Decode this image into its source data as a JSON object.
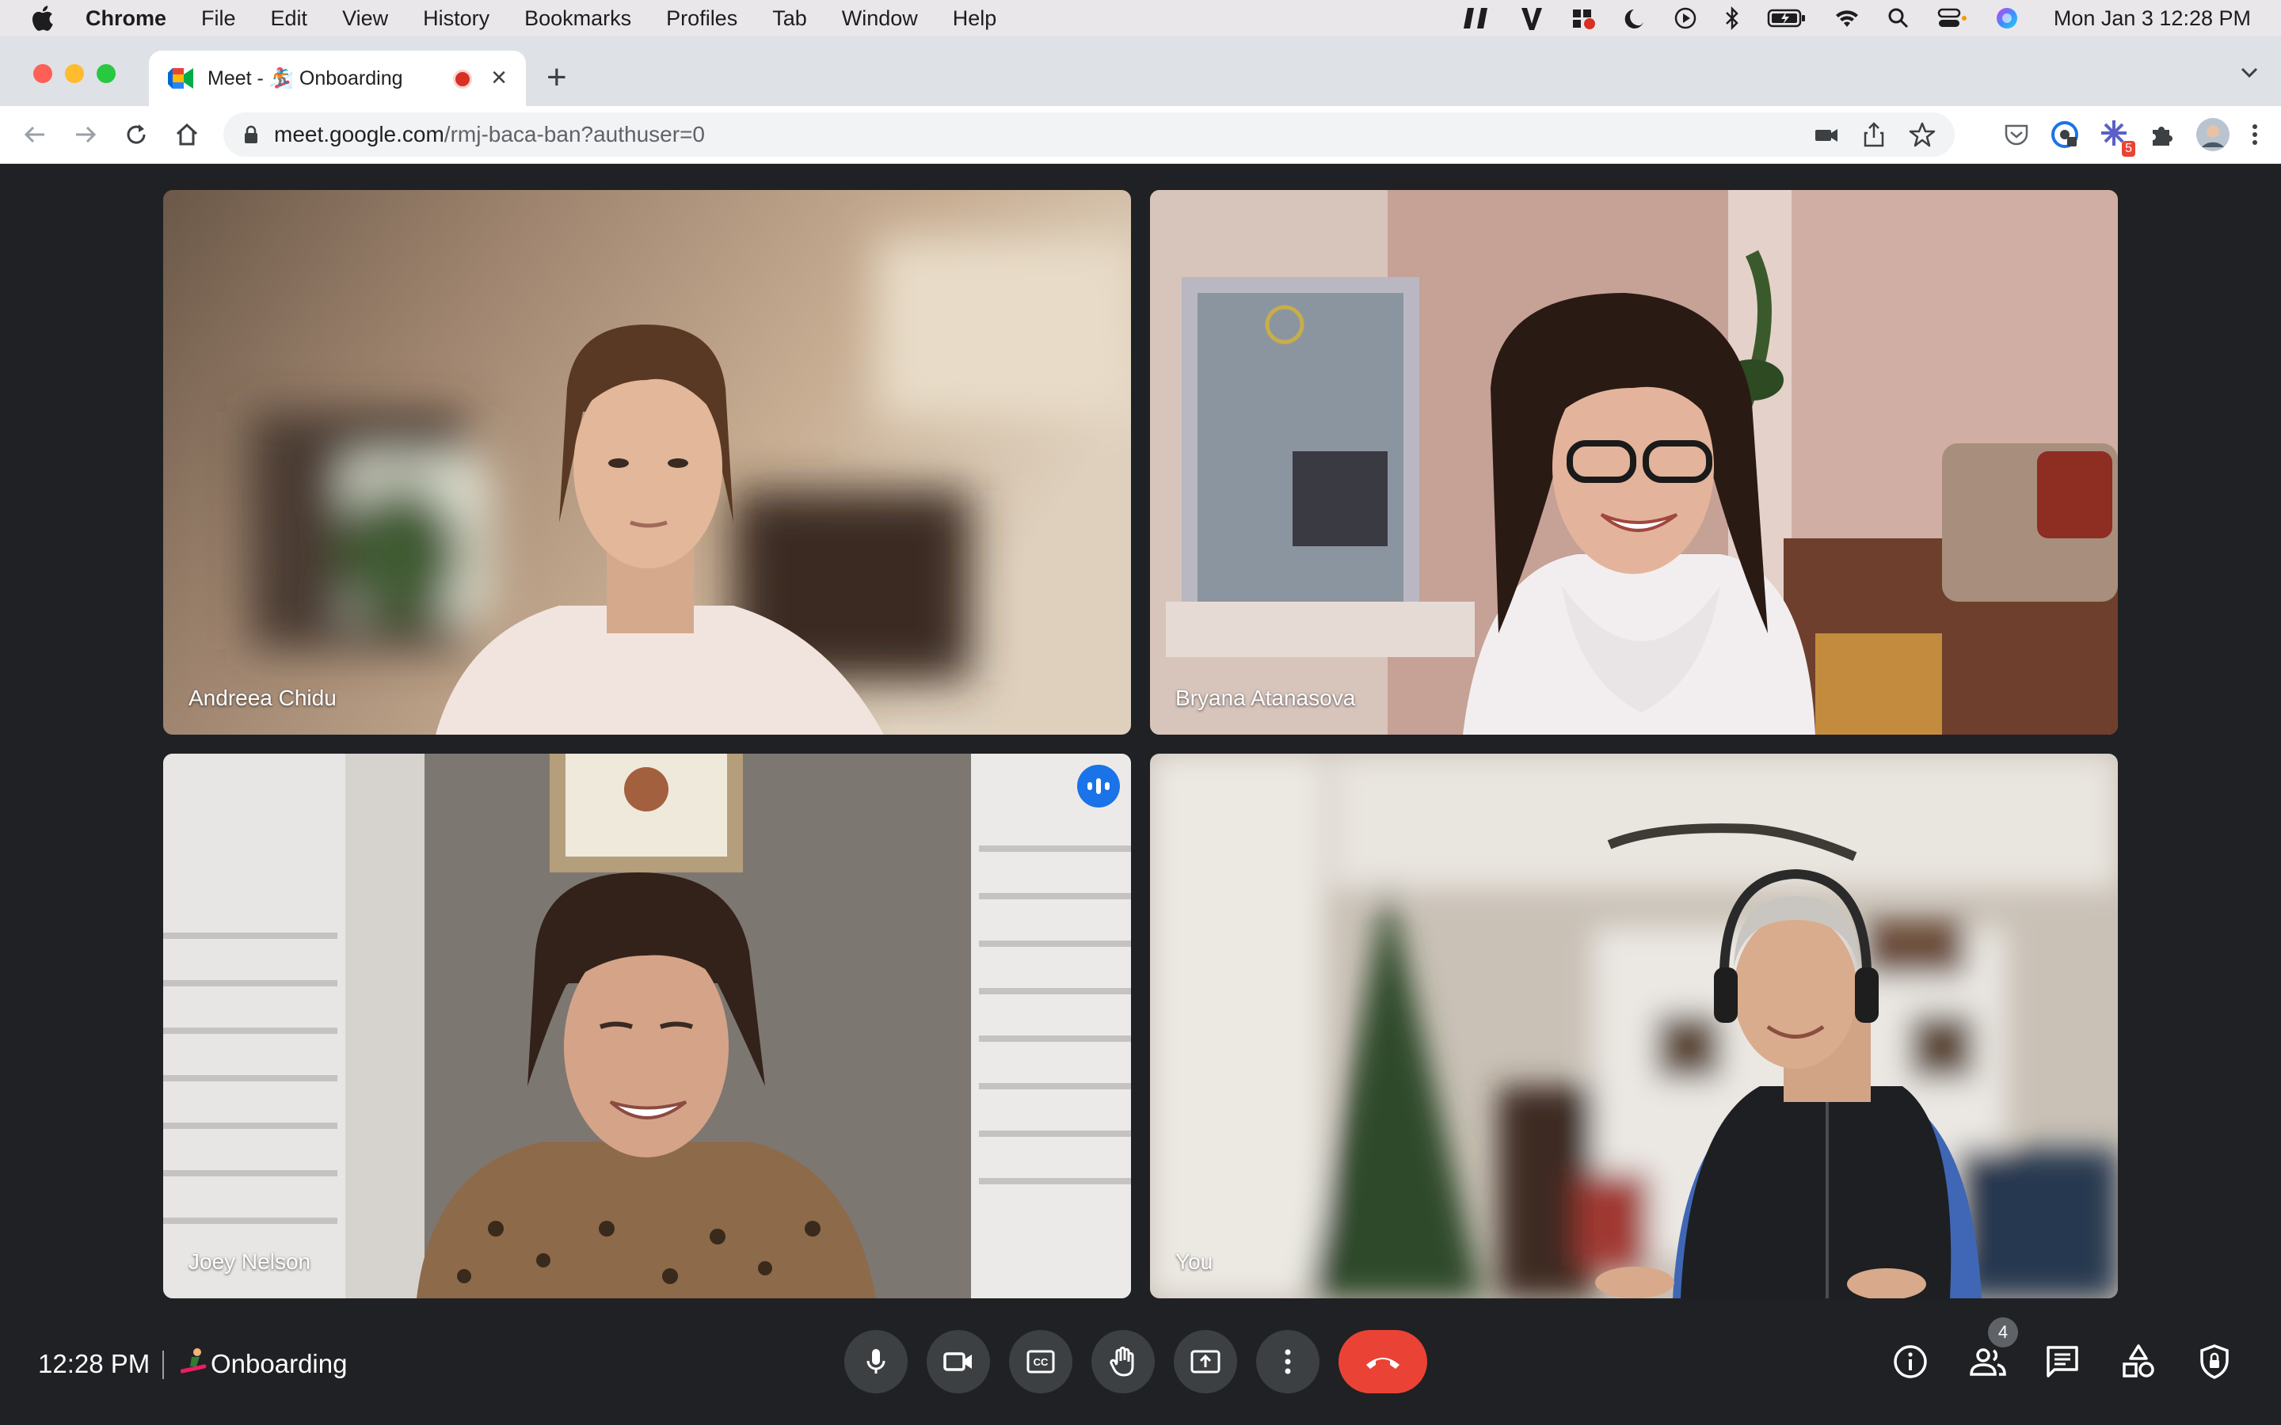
{
  "menubar": {
    "app": "Chrome",
    "items": [
      "File",
      "Edit",
      "View",
      "History",
      "Bookmarks",
      "Profiles",
      "Tab",
      "Window",
      "Help"
    ],
    "clock": "Mon Jan 3  12:28 PM"
  },
  "browser": {
    "tab_title": "Meet - 🏂 Onboarding",
    "url_host": "meet.google.com",
    "url_path": "/rmj-baca-ban?authuser=0",
    "extension_badge": "5"
  },
  "participants": [
    {
      "name": "Andreea Chidu"
    },
    {
      "name": "Bryana Atanasova"
    },
    {
      "name": "Joey Nelson",
      "speaking": true
    },
    {
      "name": "You"
    }
  ],
  "bottom_bar": {
    "time": "12:28 PM",
    "meeting_name": "Onboarding",
    "participant_count": "4"
  },
  "colors": {
    "background": "#202124",
    "control_button": "#3c4043",
    "end_call": "#ea4335",
    "active_speaker": "#8ab4f8"
  }
}
